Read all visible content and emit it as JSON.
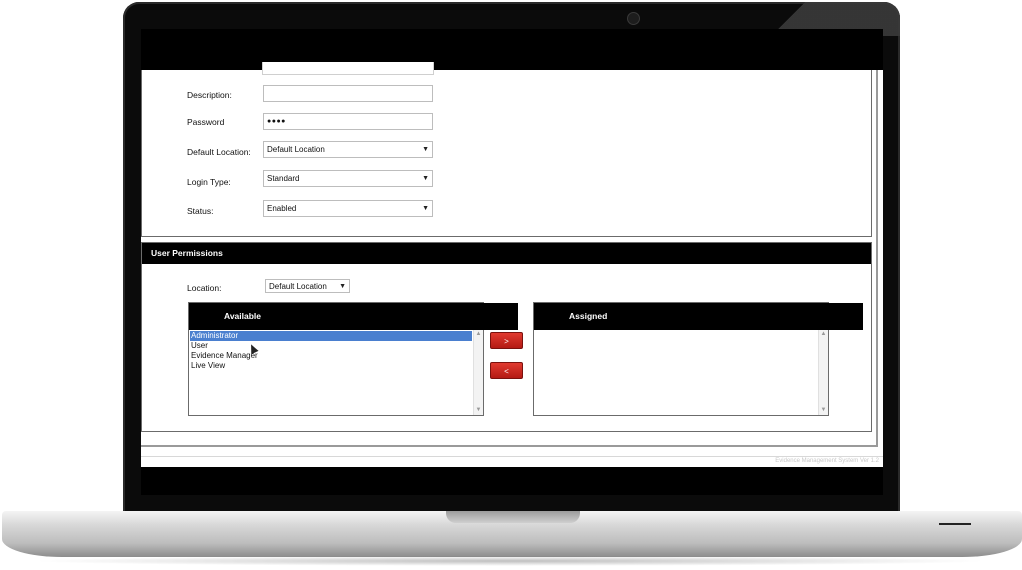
{
  "form": {
    "description_label": "Description:",
    "description_value": "",
    "password_label": "Password",
    "password_value": "●●●●",
    "default_location_label": "Default Location:",
    "default_location_value": "Default Location",
    "login_type_label": "Login Type:",
    "login_type_value": "Standard",
    "status_label": "Status:",
    "status_value": "Enabled"
  },
  "permissions": {
    "header": "User Permissions",
    "location_label": "Location:",
    "location_value": "Default Location",
    "available_header": "Available",
    "assigned_header": "Assigned",
    "available_items": [
      "Administrator",
      "User",
      "Evidence Manager",
      "Live View"
    ],
    "selected_item": "Administrator",
    "add_button": ">",
    "remove_button": "<"
  },
  "footer": {
    "text": "Evidence Management System Ver 1.2"
  },
  "icons": {
    "dropdown": "chevron-down-icon",
    "scroll_up": "scroll-up-arrow-icon",
    "scroll_down": "scroll-down-arrow-icon",
    "cursor": "mouse-pointer-icon"
  },
  "colors": {
    "header_bg": "#000000",
    "selection": "#4a7fcf",
    "button_red": "#c0201a"
  }
}
